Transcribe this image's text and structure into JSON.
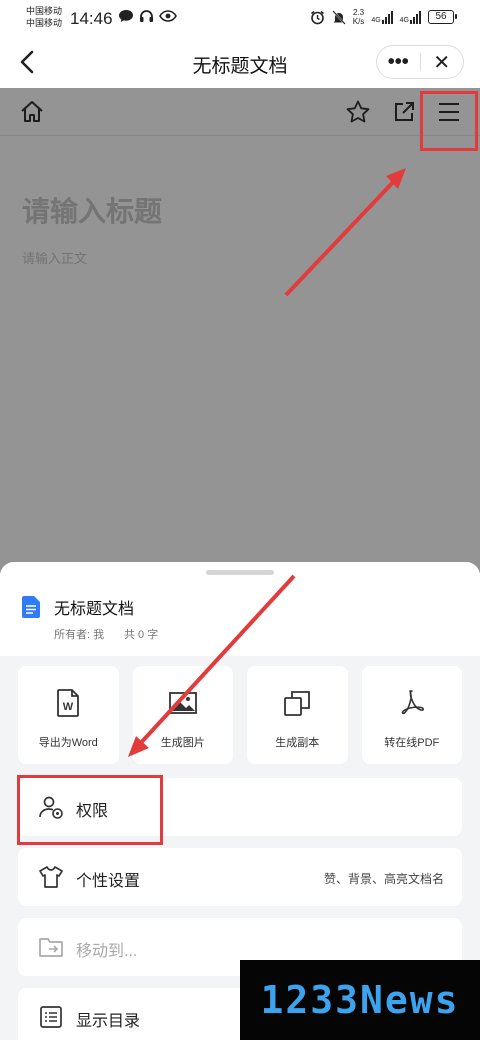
{
  "status_bar": {
    "carrier_1": "中国移动",
    "carrier_2": "中国移动",
    "time": "14:46",
    "net_speed": "2.3",
    "net_unit": "K/s",
    "sim1_label": "4G",
    "sim2_label": "4G",
    "battery": "56"
  },
  "navbar": {
    "title": "无标题文档",
    "more_label": "•••",
    "close_label": "✕"
  },
  "editor": {
    "title_placeholder": "请输入标题",
    "body_placeholder": "请输入正文"
  },
  "sheet": {
    "doc_title": "无标题文档",
    "owner": "所有者: 我",
    "word_count": "共 0 字",
    "actions": [
      {
        "label": "导出为Word",
        "icon": "word-file-icon"
      },
      {
        "label": "生成图片",
        "icon": "image-icon"
      },
      {
        "label": "生成副本",
        "icon": "copy-icon"
      },
      {
        "label": "转在线PDF",
        "icon": "pdf-icon"
      }
    ],
    "rows": [
      {
        "label": "权限",
        "icon": "user-permission-icon",
        "right": ""
      },
      {
        "label": "个性设置",
        "icon": "tshirt-icon",
        "right": "赞、背景、高亮文档名"
      },
      {
        "label": "移动到...",
        "icon": "folder-move-icon",
        "right": ""
      },
      {
        "label": "显示目录",
        "icon": "list-icon",
        "right": ""
      }
    ]
  },
  "watermark": "1233News",
  "colors": {
    "annotation": "#e23b3b",
    "doc_blue": "#2f7cf6",
    "watermark_text": "#3da3ee"
  }
}
